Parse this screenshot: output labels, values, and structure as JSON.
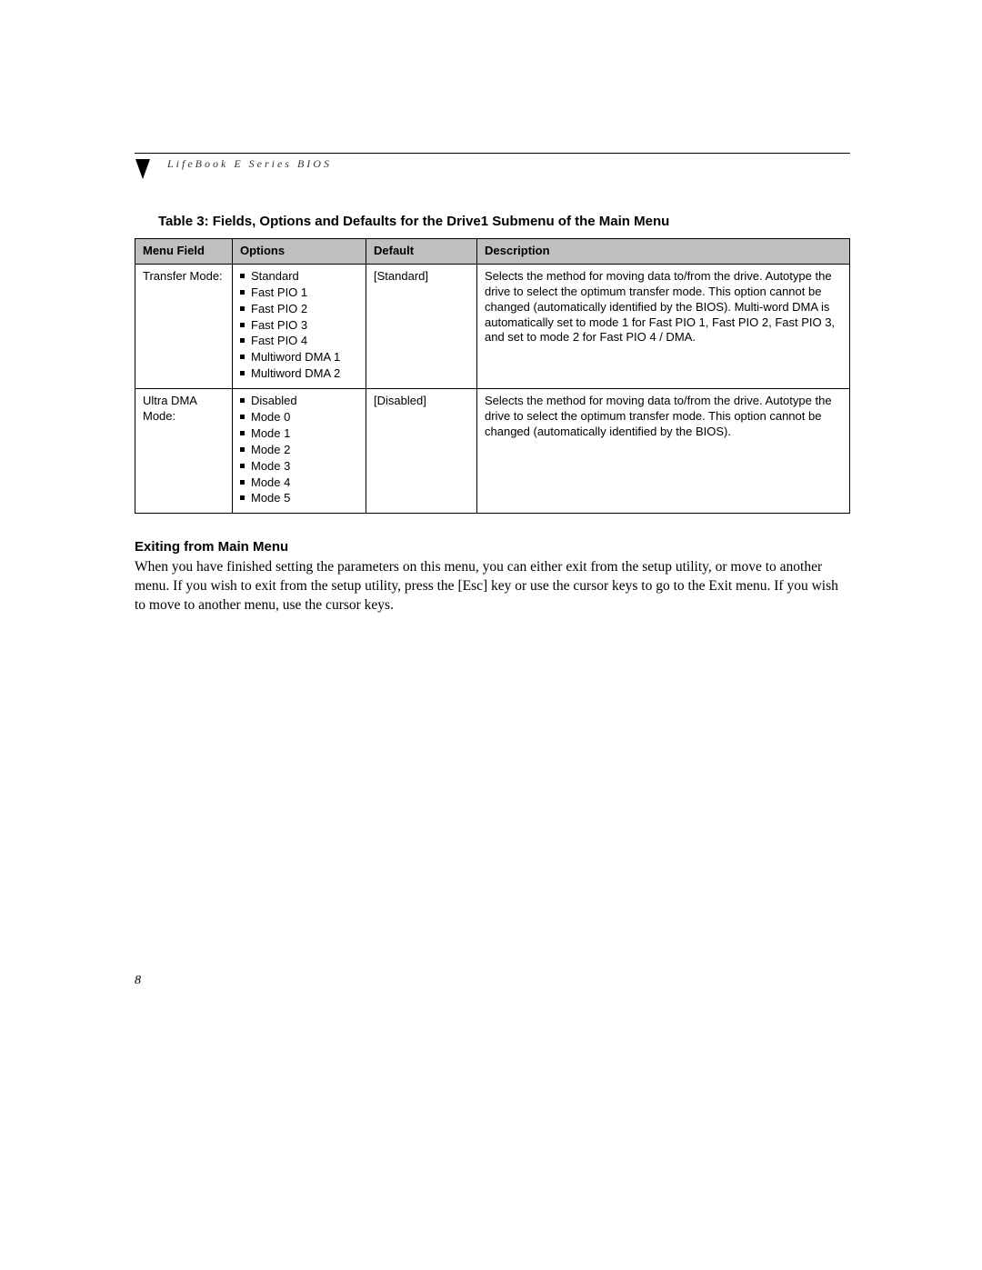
{
  "running_head": "LifeBook E Series BIOS",
  "table_caption": "Table 3: Fields, Options and Defaults for the Drive1 Submenu of the Main Menu",
  "columns": {
    "menu_field": "Menu Field",
    "options": "Options",
    "default": "Default",
    "description": "Description"
  },
  "rows": [
    {
      "menu_field": "Transfer Mode:",
      "options": [
        "Standard",
        "Fast PIO 1",
        "Fast PIO 2",
        "Fast PIO 3",
        "Fast PIO 4",
        "Multiword DMA 1",
        "Multiword DMA 2"
      ],
      "default": "[Standard]",
      "description": "Selects the method for moving data to/from the drive. Autotype the drive to select the optimum transfer mode. This option cannot be changed (automatically identified by the BIOS). Multi-word DMA is automatically set to mode 1 for Fast PIO 1, Fast PIO 2, Fast PIO 3, and set to mode 2 for Fast PIO 4 / DMA."
    },
    {
      "menu_field": "Ultra DMA Mode:",
      "options": [
        "Disabled",
        "Mode 0",
        "Mode 1",
        "Mode 2",
        "Mode 3",
        "Mode 4",
        "Mode 5"
      ],
      "default": "[Disabled]",
      "description": "Selects the method for moving data to/from the drive. Autotype the drive to select the optimum transfer mode. This option cannot be changed (automatically identified by the BIOS)."
    }
  ],
  "section_heading": "Exiting from Main Menu",
  "body_text": "When you have finished setting the parameters on this menu, you can either exit from the setup utility, or move to another menu. If you wish to exit from the setup utility, press the [Esc] key or use the cursor keys to go to the Exit menu. If you wish to move to another menu, use the cursor keys.",
  "page_number": "8"
}
